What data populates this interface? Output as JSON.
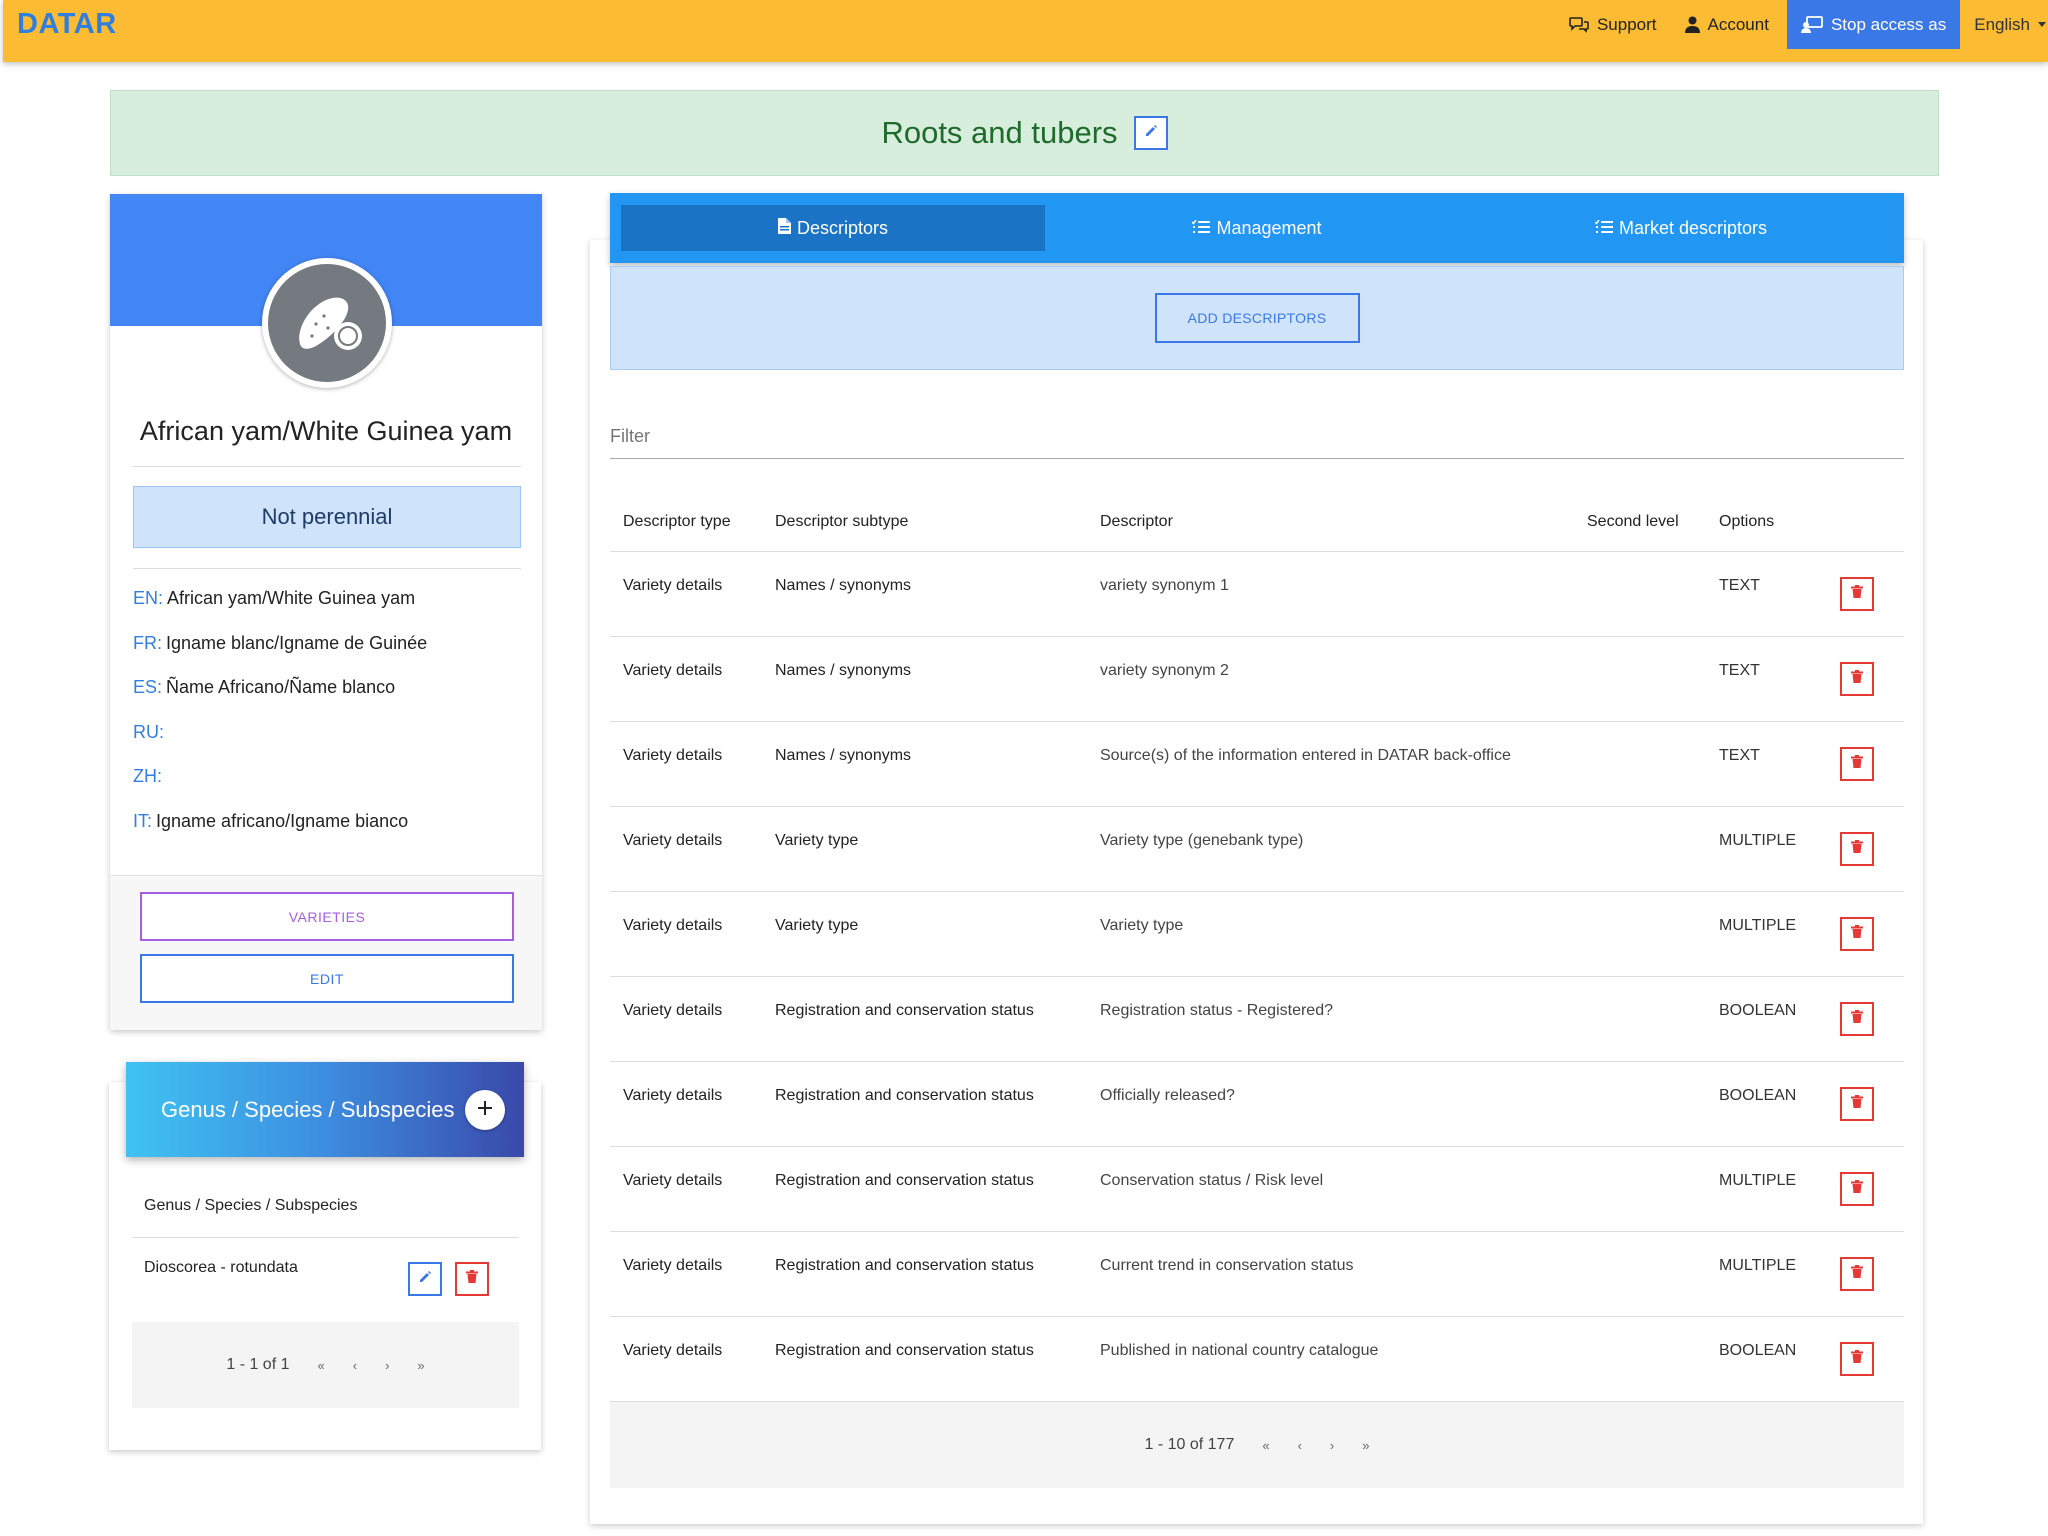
{
  "topbar": {
    "brand": "DATAR",
    "support": "Support",
    "account": "Account",
    "stop_access": "Stop access as",
    "language": "English"
  },
  "banner": {
    "title": "Roots and tubers"
  },
  "crop": {
    "name": "African yam/White Guinea yam",
    "perennial": "Not perennial",
    "names": [
      {
        "code": "EN:",
        "value": "African yam/White Guinea yam"
      },
      {
        "code": "FR:",
        "value": "Igname blanc/Igname de Guinée"
      },
      {
        "code": "ES:",
        "value": "Ñame Africano/Ñame blanco"
      },
      {
        "code": "RU:",
        "value": ""
      },
      {
        "code": "ZH:",
        "value": ""
      },
      {
        "code": "IT:",
        "value": "Igname africano/Igname bianco"
      }
    ],
    "varieties_label": "VARIETIES",
    "edit_label": "EDIT"
  },
  "genus": {
    "title": "Genus / Species / Subspecies",
    "column": "Genus / Species / Subspecies",
    "value": "Dioscorea - rotundata",
    "pagination": "1 - 1 of 1",
    "first": "«",
    "prev": "‹",
    "next": "›",
    "last": "»"
  },
  "tabs": {
    "descriptors": "Descriptors",
    "management": "Management",
    "market": "Market descriptors"
  },
  "add_descriptors": "ADD DESCRIPTORS",
  "filter_placeholder": "Filter",
  "table": {
    "headers": {
      "type": "Descriptor type",
      "subtype": "Descriptor subtype",
      "descriptor": "Descriptor",
      "second": "Second level",
      "options": "Options"
    },
    "rows": [
      {
        "type": "Variety details",
        "subtype": "Names / synonyms",
        "descriptor": "variety synonym 1",
        "second": "",
        "options": "TEXT"
      },
      {
        "type": "Variety details",
        "subtype": "Names / synonyms",
        "descriptor": "variety synonym 2",
        "second": "",
        "options": "TEXT"
      },
      {
        "type": "Variety details",
        "subtype": "Names / synonyms",
        "descriptor": "Source(s) of the information entered in DATAR back-office",
        "second": "",
        "options": "TEXT"
      },
      {
        "type": "Variety details",
        "subtype": "Variety type",
        "descriptor": "Variety type (genebank type)",
        "second": "",
        "options": "MULTIPLE"
      },
      {
        "type": "Variety details",
        "subtype": "Variety type",
        "descriptor": "Variety type",
        "second": "",
        "options": "MULTIPLE"
      },
      {
        "type": "Variety details",
        "subtype": "Registration and conservation status",
        "descriptor": "Registration status - Registered?",
        "second": "",
        "options": "BOOLEAN"
      },
      {
        "type": "Variety details",
        "subtype": "Registration and conservation status",
        "descriptor": "Officially released?",
        "second": "",
        "options": "BOOLEAN"
      },
      {
        "type": "Variety details",
        "subtype": "Registration and conservation status",
        "descriptor": "Conservation status / Risk level",
        "second": "",
        "options": "MULTIPLE"
      },
      {
        "type": "Variety details",
        "subtype": "Registration and conservation status",
        "descriptor": "Current trend in conservation status",
        "second": "",
        "options": "MULTIPLE"
      },
      {
        "type": "Variety details",
        "subtype": "Registration and conservation status",
        "descriptor": "Published in national country catalogue",
        "second": "",
        "options": "BOOLEAN"
      }
    ],
    "pagination": "1 - 10 of 177",
    "first": "«",
    "prev": "‹",
    "next": "›",
    "last": "»"
  },
  "colors": {
    "topbar": "#fbbb33",
    "brand": "#2f7fe0",
    "primary": "#3b78e7",
    "tabs": "#2196f3",
    "danger": "#e53935",
    "banner": "#d8eedd"
  },
  "icons": {
    "support": "chat-bubbles-icon",
    "account": "user-icon",
    "stop_access": "switch-user-icon",
    "descriptors_tab": "file-icon",
    "management_tab": "list-icon",
    "market_tab": "list-icon",
    "edit": "pencil-icon",
    "delete": "trash-icon",
    "add": "plus-icon"
  }
}
